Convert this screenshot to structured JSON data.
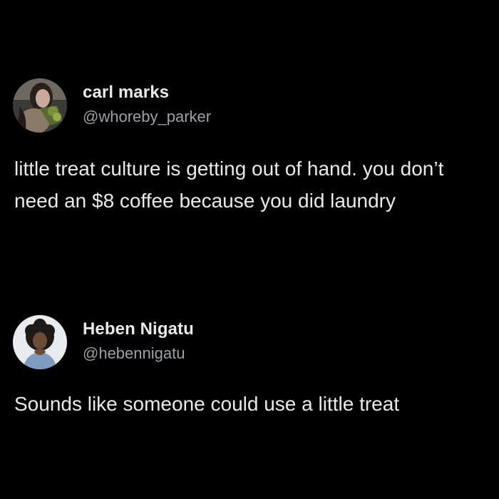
{
  "posts": [
    {
      "author_name": "carl marks",
      "author_handle": "@whoreby_parker",
      "avatar_icon": "user-avatar-photo",
      "text": "little treat culture is getting out of hand. you don’t need an $8 coffee because you did laundry"
    },
    {
      "author_name": "Heben Nigatu",
      "author_handle": "@hebennigatu",
      "avatar_icon": "user-avatar-photo",
      "text": "Sounds like someone could use a little treat"
    }
  ],
  "colors": {
    "background": "#000000",
    "primary_text": "#e7e9ea",
    "secondary_text": "#9aa0a6"
  }
}
